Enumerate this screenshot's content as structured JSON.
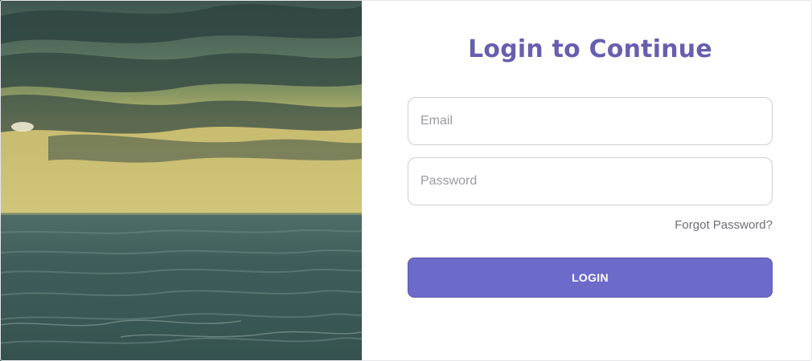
{
  "page": {
    "title": "Login to Continue"
  },
  "form": {
    "email": {
      "value": "",
      "placeholder": "Email"
    },
    "password": {
      "value": "",
      "placeholder": "Password"
    },
    "forgot_label": "Forgot Password?",
    "login_label": "LOGIN"
  },
  "hero": {
    "icon": "sea-sunset-photo"
  },
  "colors": {
    "accent": "#675fae",
    "button": "#6c6bc9",
    "button_text": "#ffffff",
    "field_border": "#cfcfd4",
    "link": "#6e6e74"
  }
}
